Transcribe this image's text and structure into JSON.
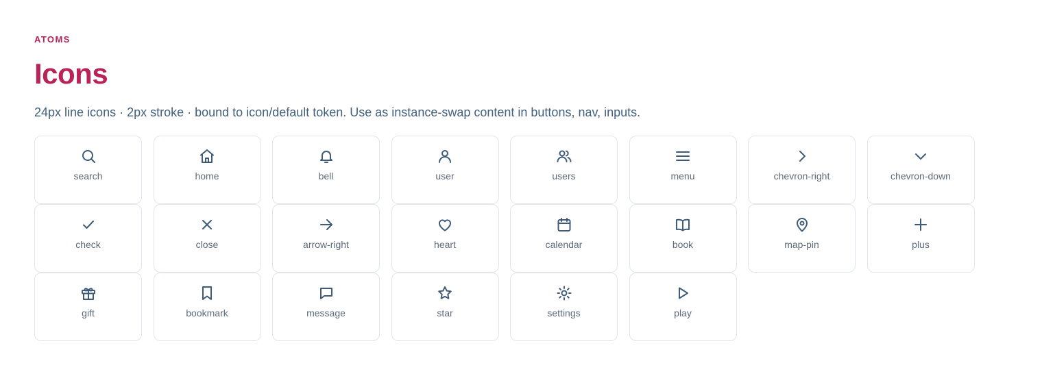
{
  "header": {
    "eyebrow": "ATOMS",
    "title": "Icons",
    "subtitle": "24px line icons · 2px stroke · bound to icon/default token. Use as instance-swap content in buttons, nav, inputs."
  },
  "colors": {
    "accent": "#b8235a",
    "subtitle_text": "#43607c",
    "icon_stroke": "#3f5b78",
    "label_text": "#5d6b7a",
    "tile_border": "#e1e5ea"
  },
  "icons": [
    {
      "label": "search",
      "icon": "search-icon"
    },
    {
      "label": "home",
      "icon": "home-icon"
    },
    {
      "label": "bell",
      "icon": "bell-icon"
    },
    {
      "label": "user",
      "icon": "user-icon"
    },
    {
      "label": "users",
      "icon": "users-icon"
    },
    {
      "label": "menu",
      "icon": "menu-icon"
    },
    {
      "label": "chevron-right",
      "icon": "chevron-right-icon"
    },
    {
      "label": "chevron-down",
      "icon": "chevron-down-icon"
    },
    {
      "label": "check",
      "icon": "check-icon"
    },
    {
      "label": "close",
      "icon": "close-icon"
    },
    {
      "label": "arrow-right",
      "icon": "arrow-right-icon"
    },
    {
      "label": "heart",
      "icon": "heart-icon"
    },
    {
      "label": "calendar",
      "icon": "calendar-icon"
    },
    {
      "label": "book",
      "icon": "book-icon"
    },
    {
      "label": "map-pin",
      "icon": "map-pin-icon"
    },
    {
      "label": "plus",
      "icon": "plus-icon"
    },
    {
      "label": "gift",
      "icon": "gift-icon"
    },
    {
      "label": "bookmark",
      "icon": "bookmark-icon"
    },
    {
      "label": "message",
      "icon": "message-icon"
    },
    {
      "label": "star",
      "icon": "star-icon"
    },
    {
      "label": "settings",
      "icon": "settings-icon"
    },
    {
      "label": "play",
      "icon": "play-icon"
    }
  ]
}
